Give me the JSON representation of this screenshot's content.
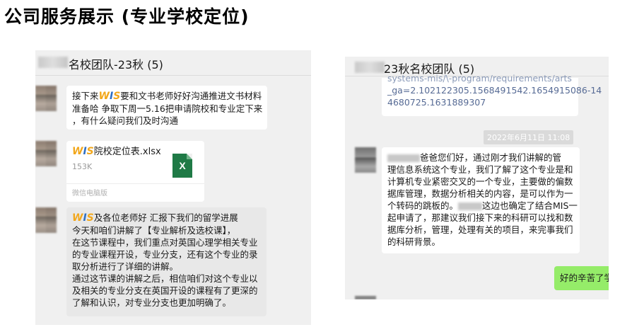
{
  "page_title": "公司服务展示 (专业学校定位)",
  "left_chat": {
    "title": "名校团队-23秋 (5)",
    "msg1": {
      "pre": "接下来",
      "logo": "WIS",
      "line1_rest": "要和文书老师好好沟通推进文书材料",
      "line2": "准备哈 争取下周一5.16把申请院校和专业定下来",
      "line3": "，有什么疑问我们及时沟通"
    },
    "file": {
      "logo": "WIS",
      "name": "院校定位表.xlsx",
      "size": "153K",
      "footer": "微信电脑版",
      "icon_letter": "X"
    },
    "msg3": {
      "logo": "WIS",
      "line1_rest": "及各位老师好 汇报下我们的留学进展",
      "lines": [
        "今天和咱们讲解了【专业解析及选校课】，",
        "在这节课程中，我们重点对英国心理学相关专业",
        "的专业课程开设，专业分支，还有这个专业的录",
        "取分析进行了详细的讲解。",
        "通过这节课的讲解之后，相信咱们对这个专业以",
        "及相关的专业分支在英国开设的课程有了更深的",
        "了解和认识，对专业分支也更加明确了。"
      ]
    }
  },
  "right_chat": {
    "title": "23秋名校团队 (5)",
    "link_lines": [
      "systems-mis/\\-program/requirements/arts",
      "_ga=2.102122305.1568491542.1654915086-14",
      "4680725.1631889307"
    ],
    "timestamp": "2022年6月11日 11:08",
    "msg": {
      "line1_rest": "爸爸您们好，通过刚才我们讲解的管",
      "lines": [
        "理信息系统这个专业，我们了解了这个专业是和",
        "计算机专业紧密交叉的一个专业，主要做的偏数",
        "据库管理，数据分析相关的内容，是可以作为一",
        "个转码的跳板的。"
      ],
      "line6_rest": "这边也确定了结合MIS一",
      "lines2": [
        "起申请了，那建议我们接下来的科研可以找和数",
        "据库分析，管理，处理有关的项目，来完事我们",
        "的科研背景。"
      ]
    },
    "reply": "好的辛苦了学"
  },
  "colors": {
    "chat_bg": "#f0f0f0",
    "bubble_white": "#ffffff",
    "bubble_green": "#95ec69",
    "logo_orange": "#f2a71b",
    "logo_blue": "#2f6fc4",
    "link": "#576b95",
    "excel_green": "#1f7a46"
  }
}
